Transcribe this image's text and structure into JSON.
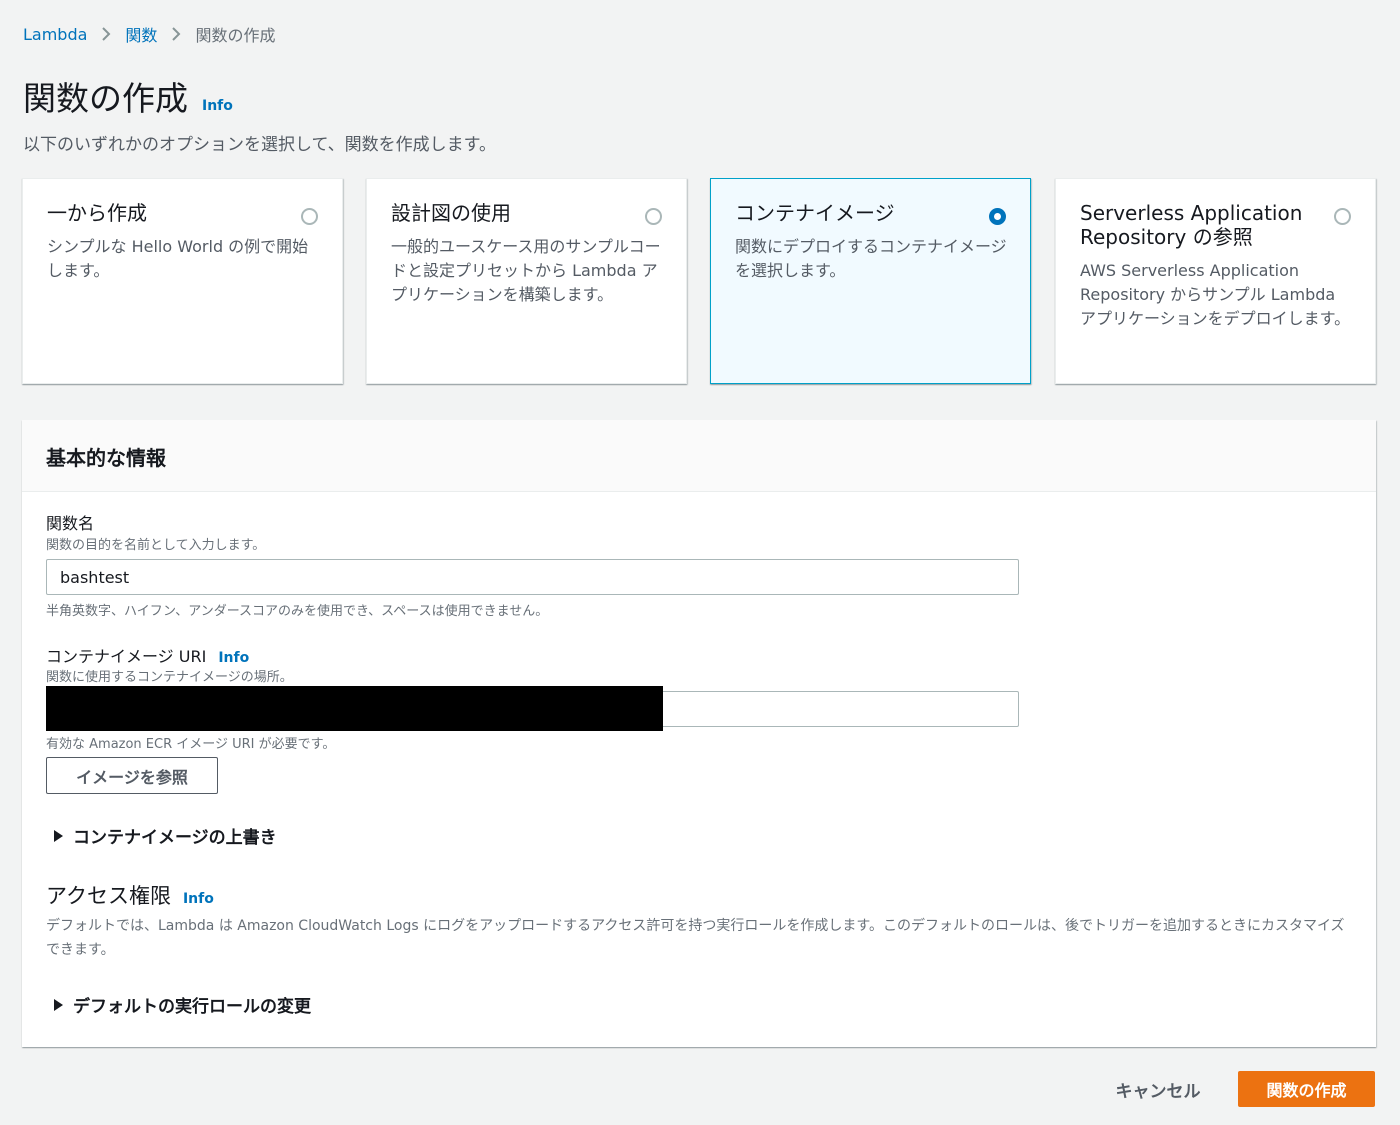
{
  "breadcrumb": {
    "items": [
      {
        "label": "Lambda"
      },
      {
        "label": "関数"
      },
      {
        "label": "関数の作成"
      }
    ]
  },
  "page": {
    "title": "関数の作成",
    "info": "Info",
    "description": "以下のいずれかのオプションを選択して、関数を作成します。"
  },
  "options": [
    {
      "title": "一から作成",
      "description": "シンプルな Hello World の例で開始します。",
      "selected": false
    },
    {
      "title": "設計図の使用",
      "description": "一般的ユースケース用のサンプルコードと設定プリセットから Lambda アプリケーションを構築します。",
      "selected": false
    },
    {
      "title": "コンテナイメージ",
      "description": "関数にデプロイするコンテナイメージを選択します。",
      "selected": true
    },
    {
      "title": "Serverless Application Repository の参照",
      "description": "AWS Serverless Application Repository からサンプル Lambda アプリケーションをデプロイします。",
      "selected": false
    }
  ],
  "basic_info": {
    "header": "基本的な情報",
    "function_name": {
      "label": "関数名",
      "description": "関数の目的を名前として入力します。",
      "value": "bashtest",
      "constraint": "半角英数字、ハイフン、アンダースコアのみを使用でき、スペースは使用できません。"
    },
    "image_uri": {
      "label": "コンテナイメージ URI",
      "info": "Info",
      "description": "関数に使用するコンテナイメージの場所。",
      "value": "",
      "constraint": "有効な Amazon ECR イメージ URI が必要です。"
    },
    "browse_button": "イメージを参照",
    "override_expander": "コンテナイメージの上書き",
    "permissions": {
      "title": "アクセス権限",
      "info": "Info",
      "description": "デフォルトでは、Lambda は Amazon CloudWatch Logs にログをアップロードするアクセス許可を持つ実行ロールを作成します。このデフォルトのロールは、後でトリガーを追加するときにカスタマイズできます。",
      "role_expander": "デフォルトの実行ロールの変更"
    }
  },
  "footer": {
    "cancel": "キャンセル",
    "create": "関数の作成"
  },
  "colors": {
    "link": "#0073bb",
    "primary_button": "#ec7211",
    "selected_card_bg": "#f1faff",
    "selected_card_border": "#00a1c9"
  }
}
